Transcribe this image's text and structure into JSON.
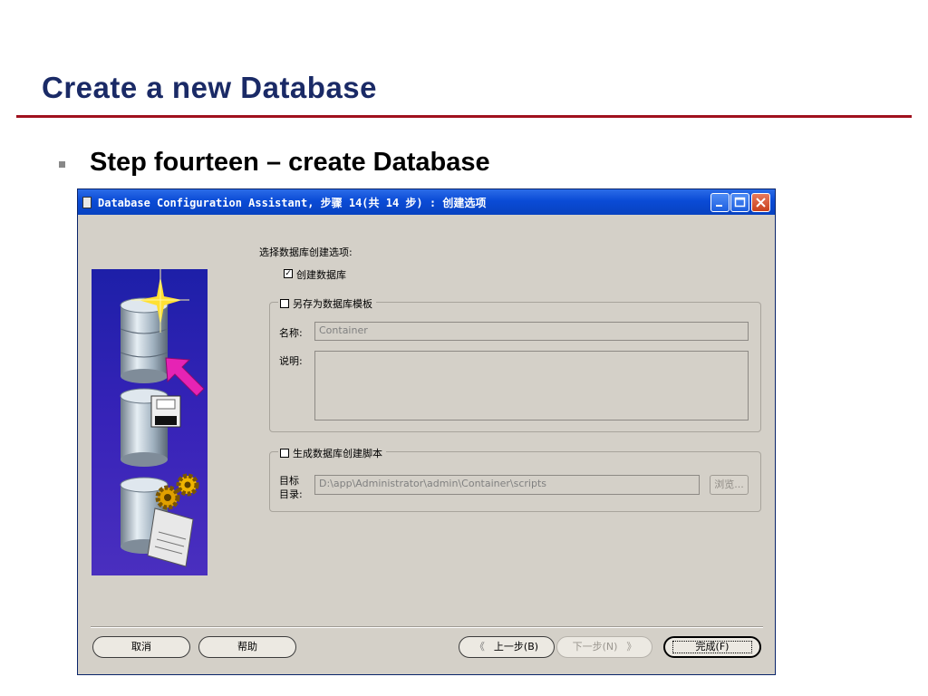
{
  "slide": {
    "title": "Create a new Database",
    "bullet": "Step fourteen – create Database"
  },
  "window": {
    "title": "Database Configuration Assistant, 步骤 14(共 14 步) : 创建选项",
    "prompt": "选择数据库创建选项:",
    "create_db_label": "创建数据库",
    "create_db_checked": "✓",
    "save_template": {
      "legend": "另存为数据库模板",
      "name_label": "名称:",
      "name_value": "Container",
      "desc_label": "说明:",
      "desc_value": ""
    },
    "gen_scripts": {
      "legend": "生成数据库创建脚本",
      "dir_label_1": "目标",
      "dir_label_2": "目录:",
      "dir_value": "D:\\app\\Administrator\\admin\\Container\\scripts",
      "browse_label": "浏览..."
    },
    "buttons": {
      "cancel": "取消",
      "help": "帮助",
      "back": "上一步(B)",
      "next": "下一步(N)",
      "finish": "完成(F)"
    }
  },
  "colors": {
    "title": "#1a2a66",
    "rule": "#a0111e",
    "titlebar": "#0a4bd6",
    "dialog_bg": "#d4d0c8"
  }
}
